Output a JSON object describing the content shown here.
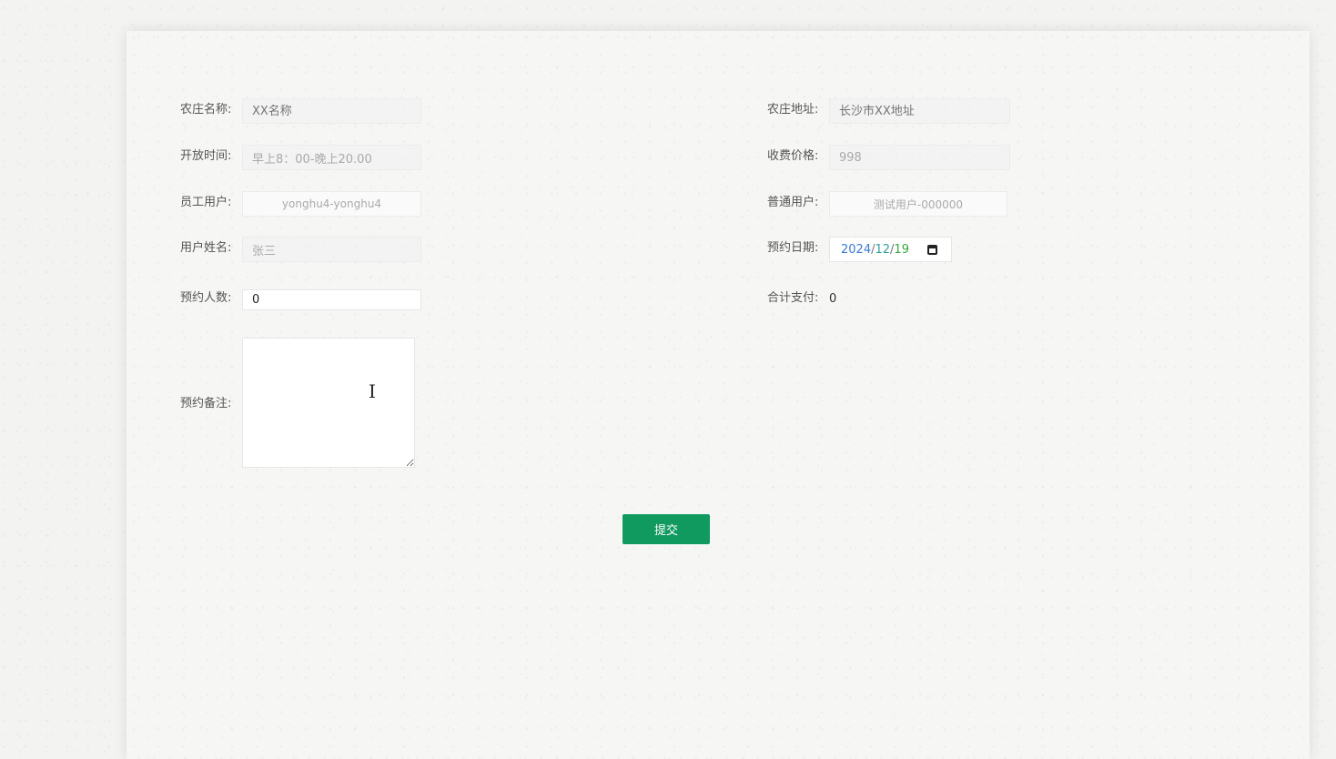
{
  "form": {
    "farm_name": {
      "label": "农庄名称:",
      "placeholder": "XX名称"
    },
    "farm_address": {
      "label": "农庄地址:",
      "placeholder": "长沙市XX地址"
    },
    "open_hours": {
      "label": "开放时间:",
      "value": "早上8：00-晚上20.00"
    },
    "price": {
      "label": "收费价格:",
      "value": "998"
    },
    "staff_user": {
      "label": "员工用户:",
      "value": "yonghu4-yonghu4"
    },
    "normal_user": {
      "label": "普通用户:",
      "value": "测试用户-000000"
    },
    "user_name": {
      "label": "用户姓名:",
      "value": "张三"
    },
    "booking_date": {
      "label": "预约日期:",
      "year": "2024",
      "month": "12",
      "day": "19",
      "separator": "/",
      "icon": "calendar-icon"
    },
    "people_count": {
      "label": "预约人数:",
      "value": "0"
    },
    "total_pay": {
      "label": "合计支付:",
      "value": "0"
    },
    "remarks": {
      "label": "预约备注:",
      "value": ""
    }
  },
  "submit_label": "提交",
  "colors": {
    "accent": "#119a5f",
    "date_year": "#3a7bd5",
    "date_month": "#2aa39a",
    "date_day": "#37a83c"
  }
}
